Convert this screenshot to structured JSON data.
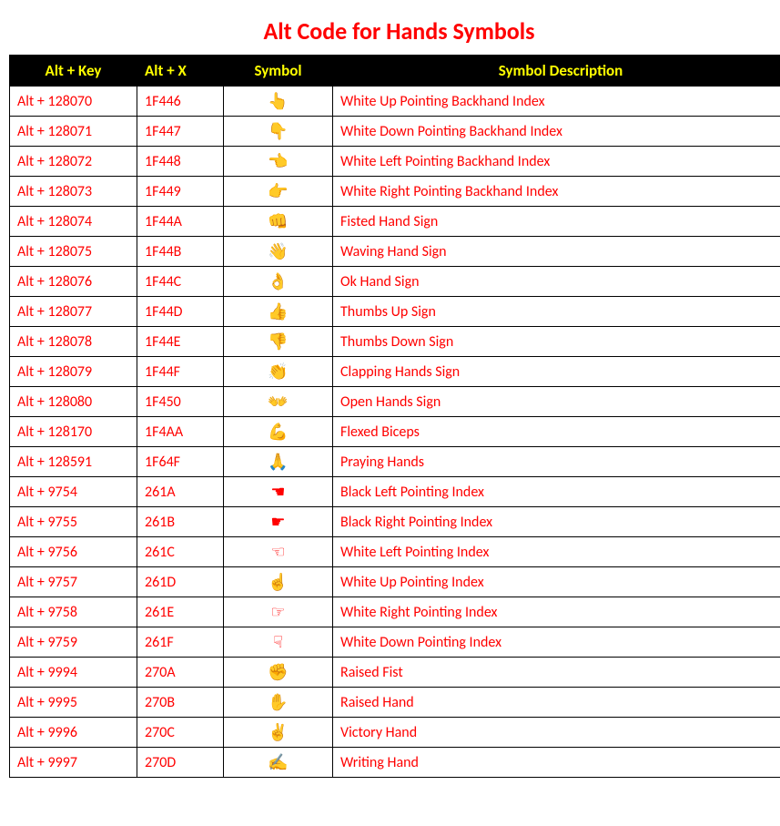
{
  "title": "Alt Code for Hands Symbols",
  "headers": [
    "Alt + Key",
    "Alt + X",
    "Symbol",
    "Symbol Description"
  ],
  "rows": [
    {
      "altkey": "Alt + 128070",
      "altx": "1F446",
      "symbol": "👆",
      "desc": "White Up Pointing Backhand Index"
    },
    {
      "altkey": "Alt + 128071",
      "altx": "1F447",
      "symbol": "👇",
      "desc": "White Down Pointing Backhand Index"
    },
    {
      "altkey": "Alt + 128072",
      "altx": "1F448",
      "symbol": "👈",
      "desc": "White Left Pointing Backhand Index"
    },
    {
      "altkey": "Alt + 128073",
      "altx": "1F449",
      "symbol": "👉",
      "desc": "White Right Pointing Backhand Index"
    },
    {
      "altkey": "Alt + 128074",
      "altx": "1F44A",
      "symbol": "👊",
      "desc": "Fisted Hand Sign"
    },
    {
      "altkey": "Alt + 128075",
      "altx": "1F44B",
      "symbol": "👋",
      "desc": "Waving Hand Sign"
    },
    {
      "altkey": "Alt + 128076",
      "altx": "1F44C",
      "symbol": "👌",
      "desc": "Ok Hand Sign"
    },
    {
      "altkey": "Alt + 128077",
      "altx": "1F44D",
      "symbol": "👍",
      "desc": "Thumbs Up Sign"
    },
    {
      "altkey": "Alt + 128078",
      "altx": "1F44E",
      "symbol": "👎",
      "desc": "Thumbs Down Sign"
    },
    {
      "altkey": "Alt + 128079",
      "altx": "1F44F",
      "symbol": "👏",
      "desc": "Clapping Hands Sign"
    },
    {
      "altkey": "Alt + 128080",
      "altx": "1F450",
      "symbol": "👐",
      "desc": "Open Hands Sign"
    },
    {
      "altkey": "Alt + 128170",
      "altx": "1F4AA",
      "symbol": "💪",
      "desc": "Flexed Biceps"
    },
    {
      "altkey": "Alt + 128591",
      "altx": "1F64F",
      "symbol": "🙏",
      "desc": "Praying Hands"
    },
    {
      "altkey": "Alt + 9754",
      "altx": "261A",
      "symbol": "☚",
      "desc": "Black Left Pointing Index"
    },
    {
      "altkey": "Alt + 9755",
      "altx": "261B",
      "symbol": "☛",
      "desc": "Black Right Pointing Index"
    },
    {
      "altkey": "Alt + 9756",
      "altx": "261C",
      "symbol": "☜",
      "desc": "White Left Pointing Index"
    },
    {
      "altkey": "Alt + 9757",
      "altx": "261D",
      "symbol": "☝",
      "desc": "White Up Pointing Index"
    },
    {
      "altkey": "Alt + 9758",
      "altx": "261E",
      "symbol": "☞",
      "desc": "White Right Pointing Index"
    },
    {
      "altkey": "Alt + 9759",
      "altx": "261F",
      "symbol": "☟",
      "desc": "White Down Pointing Index"
    },
    {
      "altkey": "Alt + 9994",
      "altx": "270A",
      "symbol": "✊",
      "desc": "Raised Fist"
    },
    {
      "altkey": "Alt + 9995",
      "altx": "270B",
      "symbol": "✋",
      "desc": "Raised Hand"
    },
    {
      "altkey": "Alt + 9996",
      "altx": "270C",
      "symbol": "✌",
      "desc": "Victory Hand"
    },
    {
      "altkey": "Alt + 9997",
      "altx": "270D",
      "symbol": "✍",
      "desc": "Writing Hand"
    }
  ]
}
